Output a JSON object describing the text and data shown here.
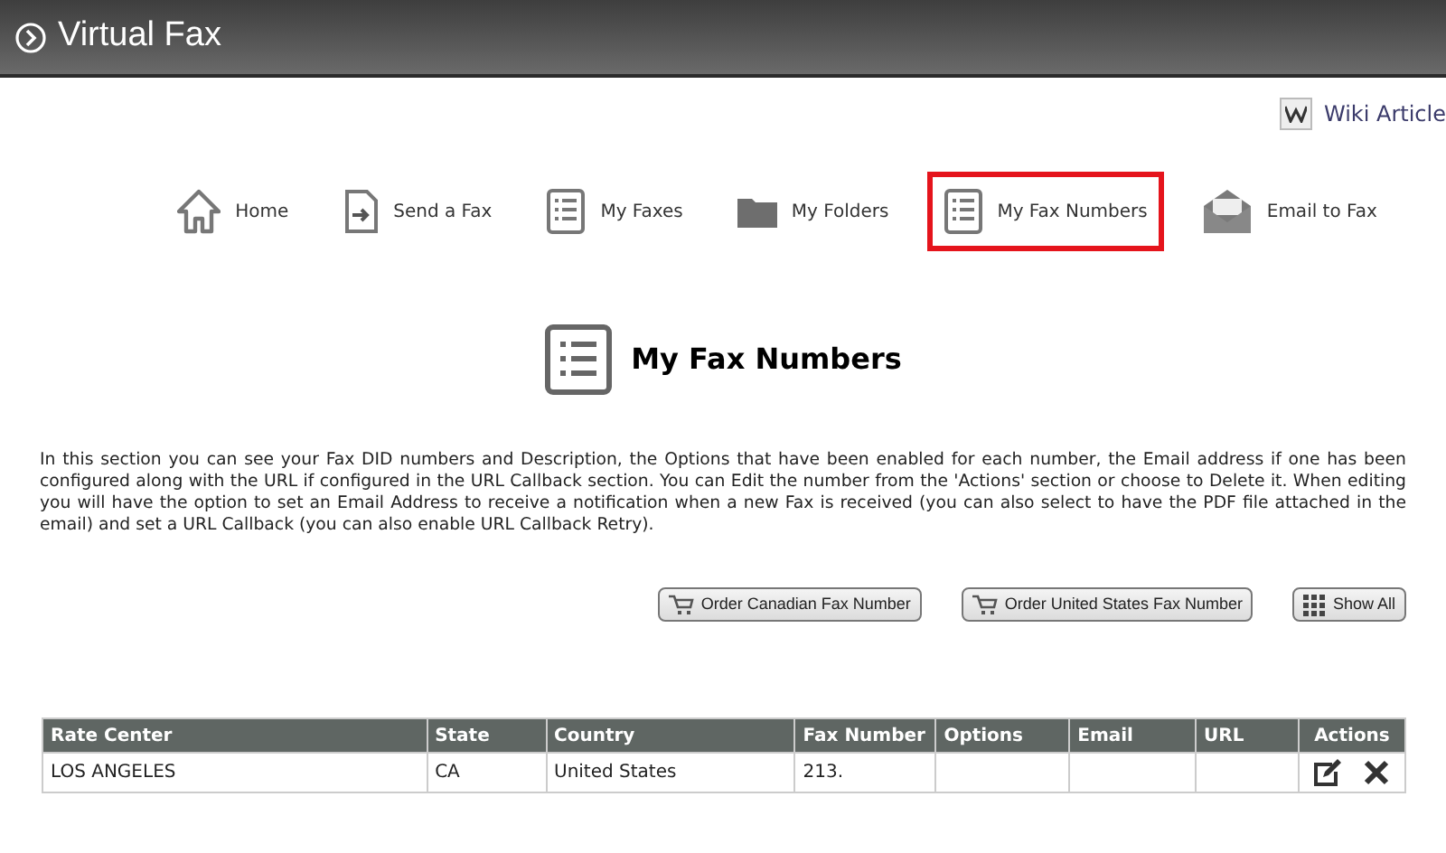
{
  "header": {
    "title": "Virtual Fax"
  },
  "wiki_link": "Wiki Article",
  "nav": [
    {
      "label": "Home",
      "kind": "home",
      "selected": false
    },
    {
      "label": "Send a Fax",
      "kind": "send",
      "selected": false
    },
    {
      "label": "My Faxes",
      "kind": "list",
      "selected": false
    },
    {
      "label": "My Folders",
      "kind": "folder",
      "selected": false
    },
    {
      "label": "My Fax Numbers",
      "kind": "list",
      "selected": true
    },
    {
      "label": "Email to Fax",
      "kind": "email",
      "selected": false
    }
  ],
  "page_title": "My Fax Numbers",
  "description": "In this section you can see your Fax DID numbers and Description, the Options that have been enabled for each number, the Email address if one has been configured along with the URL if configured in the URL Callback section. You can Edit the number from the 'Actions' section or choose to Delete it. When editing you will have the option to set an Email Address to receive a notification when a new Fax is received (you can also select to have the PDF file attached in the email) and set a URL Callback (you can also enable URL Callback Retry).",
  "buttons": [
    {
      "label": "Order Canadian Fax Number",
      "kind": "cart"
    },
    {
      "label": "Order United States Fax Number",
      "kind": "cart"
    },
    {
      "label": "Show All",
      "kind": "grid"
    }
  ],
  "table": {
    "columns": [
      "Rate Center",
      "State",
      "Country",
      "Fax Number",
      "Options",
      "Email",
      "URL",
      "Actions"
    ],
    "rows": [
      {
        "cells": [
          "LOS ANGELES",
          "CA",
          "United States",
          "213.",
          "",
          "",
          ""
        ]
      }
    ]
  }
}
